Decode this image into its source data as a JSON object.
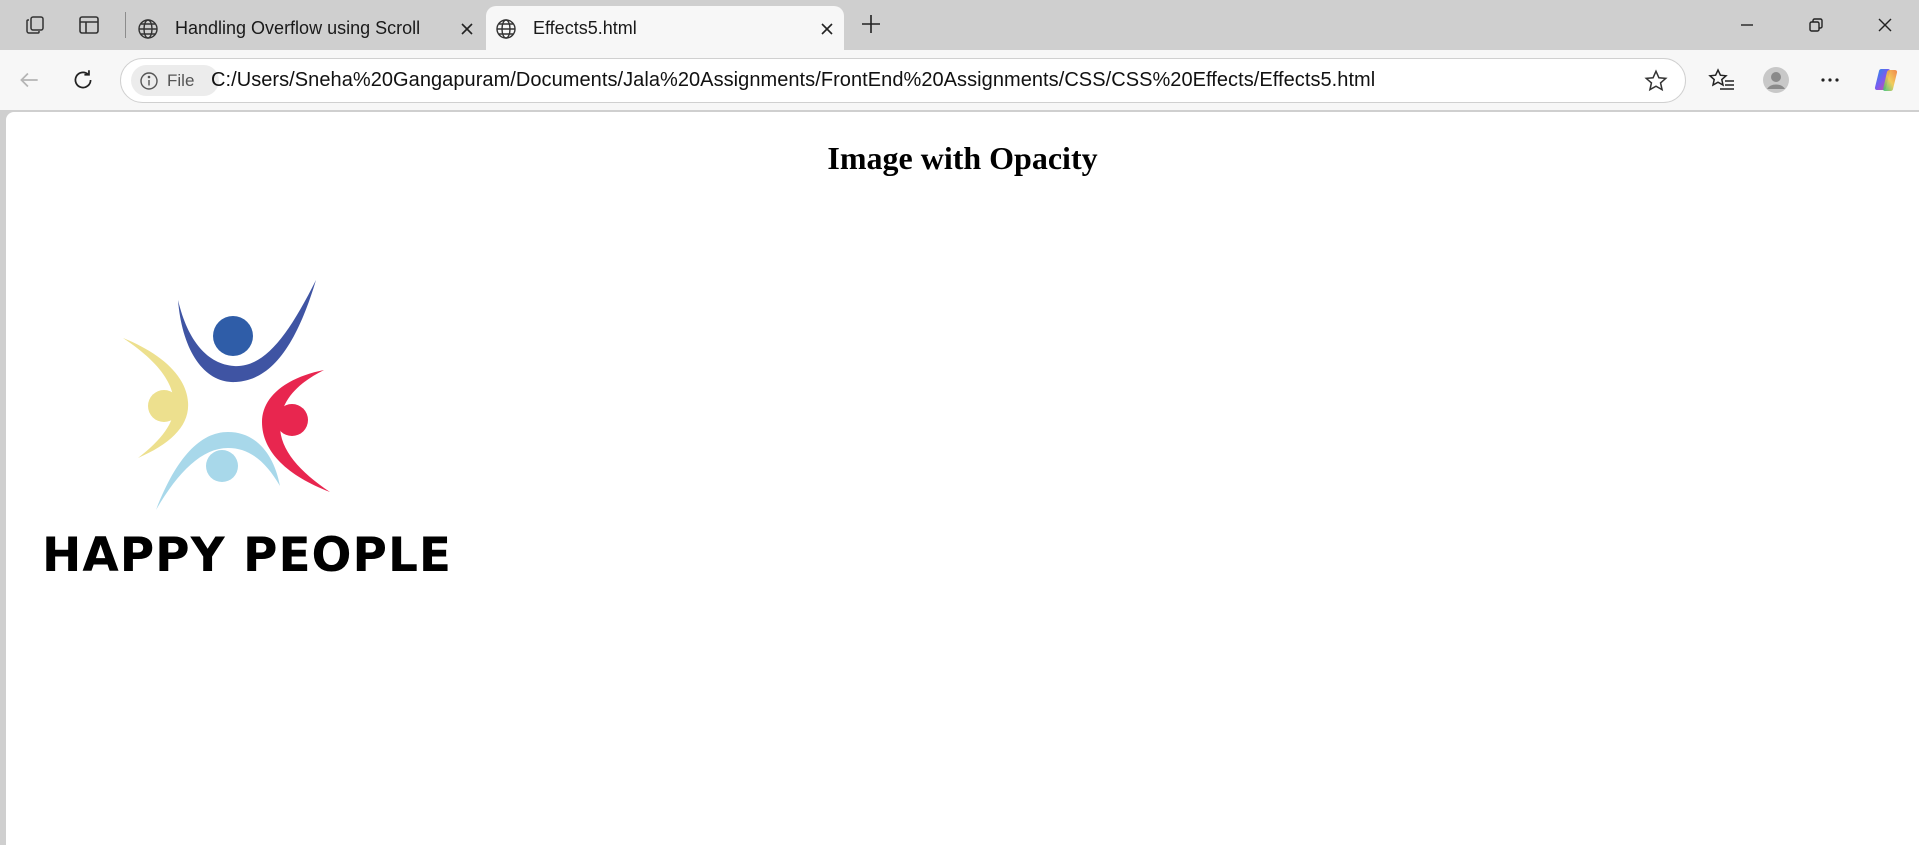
{
  "browser": {
    "tabs": [
      {
        "title": "Handling Overflow using Scroll",
        "active": false,
        "icon": "globe-icon"
      },
      {
        "title": "Effects5.html",
        "active": true,
        "icon": "globe-icon"
      }
    ],
    "address_bar": {
      "scheme_chip": "File",
      "url": "C:/Users/Sneha%20Gangapuram/Documents/Jala%20Assignments/FrontEnd%20Assignments/CSS/CSS%20Effects/Effects5.html"
    },
    "icons": [
      "workspaces-icon",
      "tab-actions-icon",
      "globe-icon",
      "close-icon",
      "new-tab-icon",
      "minimize-icon",
      "restore-icon",
      "window-close-icon",
      "back-icon",
      "refresh-icon",
      "info-icon",
      "star-icon",
      "favorites-icon",
      "profile-icon",
      "more-icon",
      "copilot-icon"
    ]
  },
  "page": {
    "heading": "Image with Opacity",
    "logo": {
      "text": "HAPPY PEOPLE",
      "colors": {
        "blue": "#2f5da8",
        "yellow": "#ede08e",
        "red": "#e8264f",
        "light_blue": "#a8d8ea"
      }
    }
  }
}
